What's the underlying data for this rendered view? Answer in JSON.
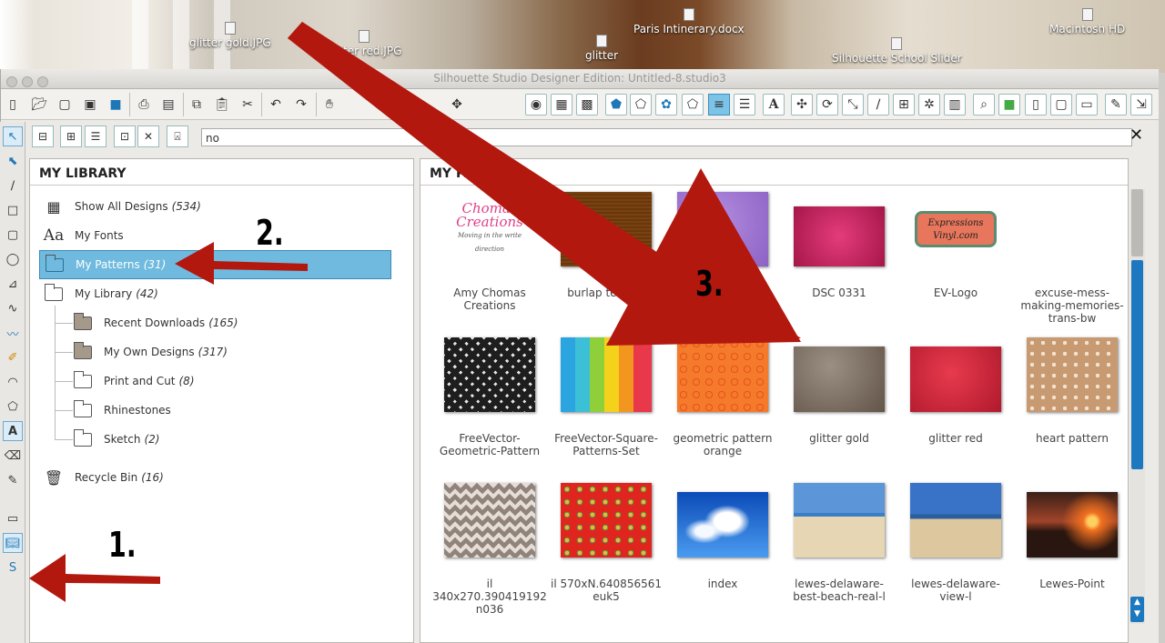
{
  "desktop": {
    "icons": [
      {
        "label": "glitter gold.JPG"
      },
      {
        "label": "glitter red.JPG"
      },
      {
        "label": "glitter"
      },
      {
        "label": "Paris Intinerary.docx"
      },
      {
        "label": "Silhouette School Slider"
      },
      {
        "label": "Macintosh HD"
      }
    ]
  },
  "window": {
    "title": "Silhouette Studio Designer Edition: Untitled-8.studio3"
  },
  "search": {
    "value": "no"
  },
  "library": {
    "heading": "MY LIBRARY",
    "items": [
      {
        "label": "Show All Designs",
        "count": "(534)"
      },
      {
        "label": "My Fonts",
        "count": ""
      },
      {
        "label": "My Patterns",
        "count": "(31)"
      },
      {
        "label": "My Library",
        "count": "(42)"
      },
      {
        "label": "Recent Downloads",
        "count": "(165)"
      },
      {
        "label": "My Own Designs",
        "count": "(317)"
      },
      {
        "label": "Print and Cut",
        "count": "(8)"
      },
      {
        "label": "Rhinestones",
        "count": ""
      },
      {
        "label": "Sketch",
        "count": "(2)"
      },
      {
        "label": "Recycle Bin",
        "count": "(16)"
      }
    ],
    "font_icon_text": "Aa"
  },
  "patterns": {
    "heading": "MY PA",
    "items": [
      {
        "label": "Amy Chomas Creations",
        "logo_line1": "Chomas",
        "logo_line2": "Creations",
        "logo_tag": "Moving in the write direction"
      },
      {
        "label": "burlap texture"
      },
      {
        "label": "purple glitter"
      },
      {
        "label": "DSC 0331"
      },
      {
        "label": "EV-Logo",
        "logo_line1": "Expressions",
        "logo_line2": "Vinyl.com"
      },
      {
        "label": "excuse-mess-making-memories-trans-bw"
      },
      {
        "label": "FreeVector-Geometric-Pattern"
      },
      {
        "label": "FreeVector-Square-Patterns-Set"
      },
      {
        "label": "geometric pattern orange"
      },
      {
        "label": "glitter gold"
      },
      {
        "label": "glitter red"
      },
      {
        "label": "heart pattern"
      },
      {
        "label": "il 340x270.390419192 n036"
      },
      {
        "label": "il 570xN.640856561 euk5"
      },
      {
        "label": "index"
      },
      {
        "label": "lewes-delaware-best-beach-real-l"
      },
      {
        "label": "lewes-delaware-view-l"
      },
      {
        "label": "Lewes-Point"
      }
    ]
  },
  "annotations": {
    "step1": "1.",
    "step2": "2.",
    "step3": "3.",
    "arrow_color": "#b3180f"
  },
  "colors": {
    "accent": "#1d79bf",
    "selection": "#6fbade"
  }
}
